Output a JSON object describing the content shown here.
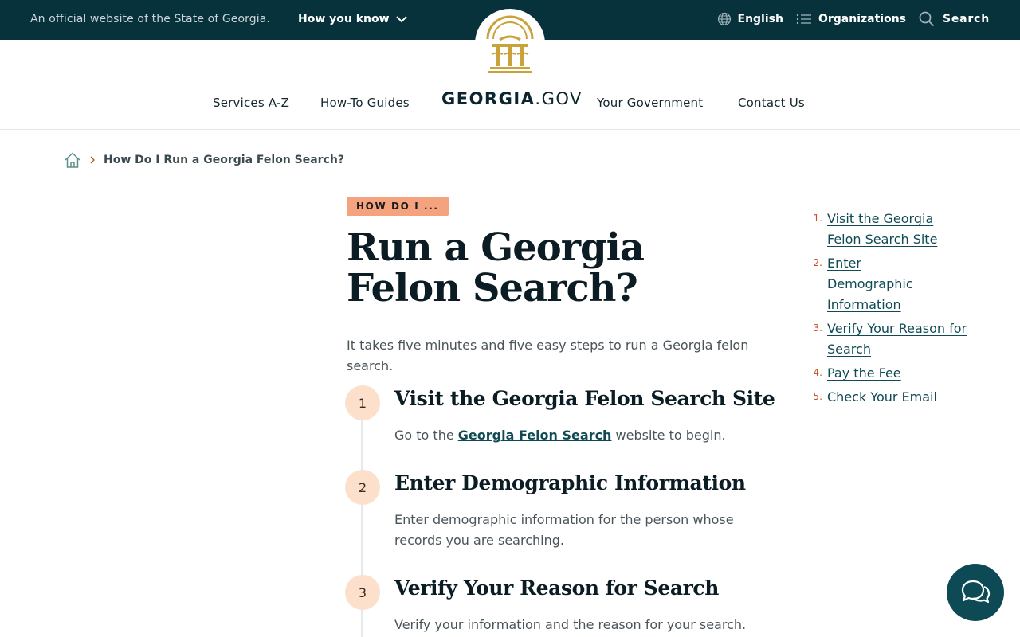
{
  "banner": {
    "official_text": "An official website of the State of Georgia.",
    "how_you_know": "How you know",
    "language": "English",
    "organizations": "Organizations",
    "search": "Search"
  },
  "nav": {
    "items": [
      "Services A-Z",
      "How-To Guides",
      "Your Government",
      "Contact Us"
    ],
    "brand_bold": "GEORGIA",
    "brand_rest": ".GOV"
  },
  "breadcrumb": {
    "current": "How Do I Run a Georgia Felon Search?"
  },
  "article": {
    "kicker": "HOW DO I ...",
    "title": "Run a Georgia Felon Search?",
    "intro": "It takes five minutes and five easy steps to run a Georgia felon search.",
    "steps": [
      {
        "number": "1",
        "heading": "Visit the Georgia Felon Search Site",
        "text_before": "Go to the ",
        "link": "Georgia Felon Search",
        "text_after": " website to begin."
      },
      {
        "number": "2",
        "heading": "Enter Demographic Information",
        "text": "Enter demographic information for the person whose records you are searching."
      },
      {
        "number": "3",
        "heading": "Verify Your Reason for Search",
        "text": "Verify your information and the reason for your search."
      }
    ]
  },
  "toc": [
    {
      "number": "1.",
      "label": "Visit the Georgia Felon Search Site"
    },
    {
      "number": "2.",
      "label": "Enter Demographic Information"
    },
    {
      "number": "3.",
      "label": "Verify Your Reason for Search"
    },
    {
      "number": "4.",
      "label": "Pay the Fee"
    },
    {
      "number": "5.",
      "label": "Check Your Email"
    }
  ],
  "colors": {
    "banner_bg": "#07323b",
    "accent_kicker": "#f5a27f",
    "step_circle": "#fde0cc",
    "seal_gold": "#c9a23a",
    "link": "#0f4a55",
    "toc_number": "#c4532c"
  },
  "icons": {
    "language": "globe-icon",
    "organizations": "list-icon",
    "search": "search-icon",
    "breadcrumb_home": "home-icon",
    "chat": "chat-bubbles-icon"
  }
}
